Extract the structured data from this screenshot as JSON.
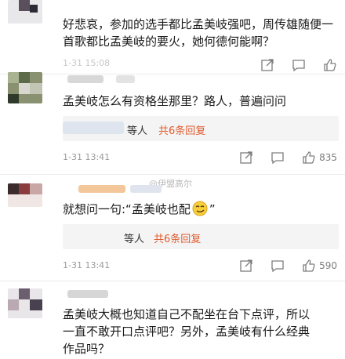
{
  "comments": [
    {
      "text": "好悲哀，参加的选手都比孟美岐强吧，周传雄随便一首歌都比孟美岐的要火，她何德何能啊？",
      "time": "1-31 15:08"
    },
    {
      "text": "孟美岐怎么有资格坐那里？路人，普遍问问",
      "reply_prefix": "等人",
      "reply_count": "共6条回复",
      "time": "1-31 13:41",
      "likes": "835"
    },
    {
      "text": "就想问一句:“孟美岐也配",
      "text_end": "”",
      "reply_prefix": "等人",
      "reply_count": "共6条回复",
      "time": "1-31 13:41",
      "likes": "590"
    },
    {
      "text_line1": "孟美岐大概也知道自己不配坐在台下点评，所以",
      "text_line2": "一直不敢开口点评吧？另外，孟美岐有什么经典",
      "text_line3": "作品吗？"
    }
  ],
  "watermark": "@伊盟高尔",
  "colors": {
    "reply_accent": "#e05b2e",
    "meta": "#9b9b9b"
  },
  "icons": [
    "share-icon",
    "comment-icon",
    "like-icon",
    "emoji-smirk-icon"
  ]
}
